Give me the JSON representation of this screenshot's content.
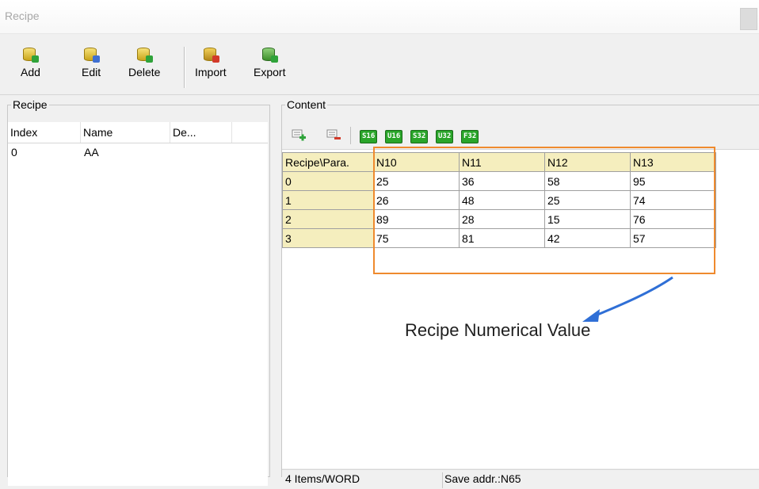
{
  "window": {
    "title": "Recipe"
  },
  "toolbar": {
    "add_label": "Add",
    "edit_label": "Edit",
    "delete_label": "Delete",
    "import_label": "Import",
    "export_label": "Export"
  },
  "recipe_panel": {
    "legend": "Recipe",
    "columns": [
      "Index",
      "Name",
      "De..."
    ],
    "rows": [
      {
        "index": "0",
        "name": "AA",
        "desc": ""
      }
    ]
  },
  "content_panel": {
    "legend": "Content",
    "formats": [
      "S16",
      "U16",
      "S32",
      "U32",
      "F32"
    ],
    "grid": {
      "corner": "Recipe\\Para.",
      "columns": [
        "N10",
        "N11",
        "N12",
        "N13"
      ],
      "rows": [
        {
          "label": "0",
          "values": [
            "25",
            "36",
            "58",
            "95"
          ]
        },
        {
          "label": "1",
          "values": [
            "26",
            "48",
            "25",
            "74"
          ]
        },
        {
          "label": "2",
          "values": [
            "89",
            "28",
            "15",
            "76"
          ]
        },
        {
          "label": "3",
          "values": [
            "75",
            "81",
            "42",
            "57"
          ]
        }
      ]
    },
    "annotation": "Recipe Numerical Value",
    "highlight_color": "#ef8a2e",
    "arrow_color": "#2f6fd6"
  },
  "status": {
    "items": "4 Items/WORD",
    "save_addr": "Save addr.:N65"
  }
}
